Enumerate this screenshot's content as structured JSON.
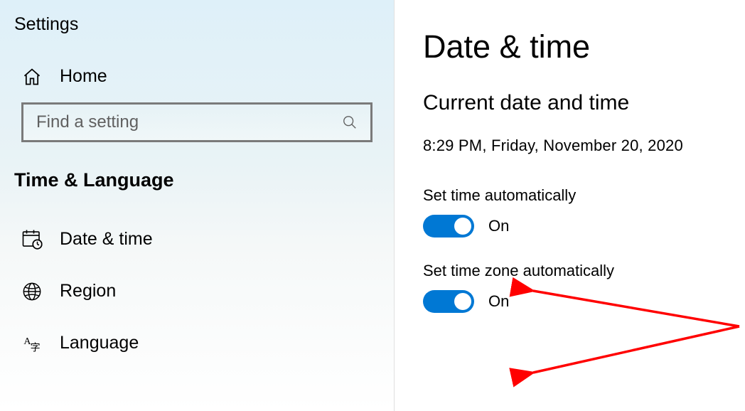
{
  "app_title": "Settings",
  "home_label": "Home",
  "search": {
    "placeholder": "Find a setting"
  },
  "section_title": "Time & Language",
  "sidebar": {
    "items": [
      {
        "label": "Date & time"
      },
      {
        "label": "Region"
      },
      {
        "label": "Language"
      }
    ]
  },
  "main": {
    "page_title": "Date & time",
    "subhead": "Current date and time",
    "current_datetime": "8:29 PM, Friday, November 20, 2020",
    "settings": [
      {
        "label": "Set time automatically",
        "state": "On"
      },
      {
        "label": "Set time zone automatically",
        "state": "On"
      }
    ]
  }
}
